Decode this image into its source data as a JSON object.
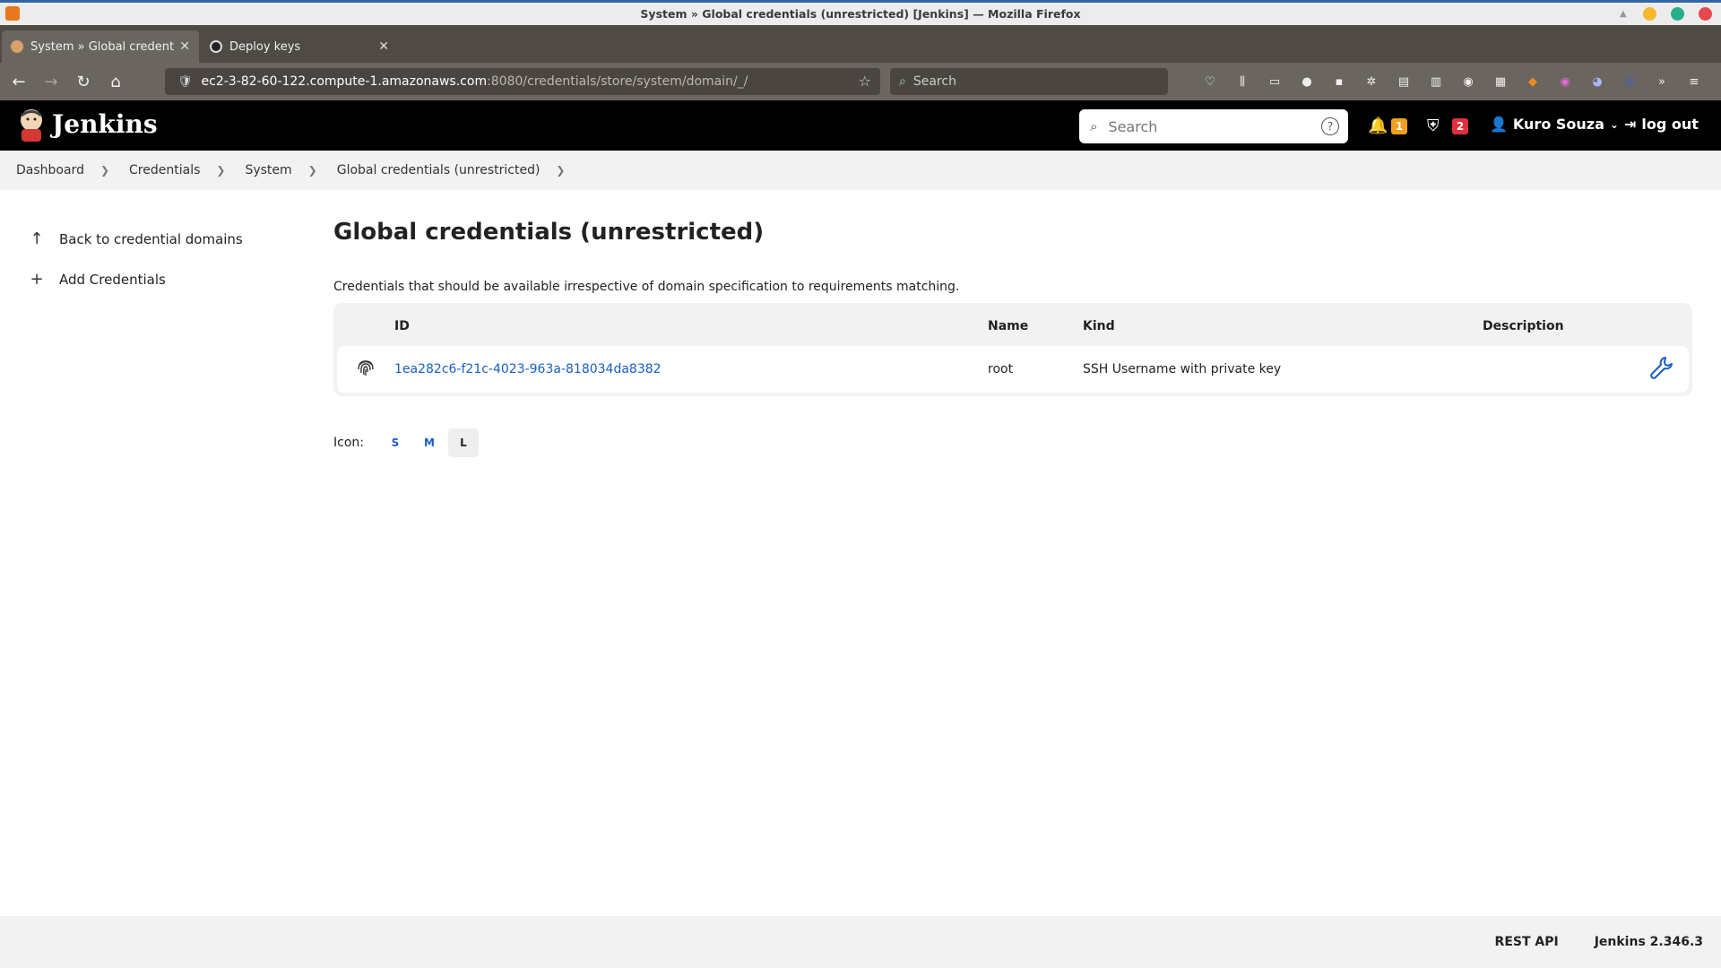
{
  "window": {
    "title": "System » Global credentials (unrestricted) [Jenkins] — Mozilla Firefox"
  },
  "tabs": [
    {
      "label": "System » Global credentials (unrestricted)",
      "active": true
    },
    {
      "label": "Deploy keys",
      "active": false
    }
  ],
  "navbar": {
    "url_host": "ec2-3-82-60-122.compute-1.amazonaws.com",
    "url_path": ":8080/credentials/store/system/domain/_/",
    "search_placeholder": "Search"
  },
  "jenkins": {
    "brand": "Jenkins",
    "search_placeholder": "Search",
    "notifications_count": "1",
    "security_count": "2",
    "user_name": "Kuro Souza",
    "logout_label": "log out",
    "colors": {
      "notify_badge": "#f0a020",
      "security_badge": "#e03040",
      "link": "#1a5ec2"
    }
  },
  "breadcrumbs": [
    "Dashboard",
    "Credentials",
    "System",
    "Global credentials (unrestricted)"
  ],
  "sidebar": {
    "items": [
      {
        "label": "Back to credential domains",
        "icon": "arrow-up-icon"
      },
      {
        "label": "Add Credentials",
        "icon": "plus-icon"
      }
    ]
  },
  "main": {
    "title": "Global credentials (unrestricted)",
    "description": "Credentials that should be available irrespective of domain specification to requirements matching.",
    "columns": {
      "id": "ID",
      "name": "Name",
      "kind": "Kind",
      "description": "Description"
    },
    "rows": [
      {
        "id": "1ea282c6-f21c-4023-963a-818034da8382",
        "name": "root",
        "kind": "SSH Username with private key",
        "description": ""
      }
    ],
    "icon_size_label": "Icon:",
    "icon_sizes": [
      "S",
      "M",
      "L"
    ],
    "selected_icon_size": "L"
  },
  "footer": {
    "rest_api": "REST API",
    "version": "Jenkins 2.346.3"
  }
}
